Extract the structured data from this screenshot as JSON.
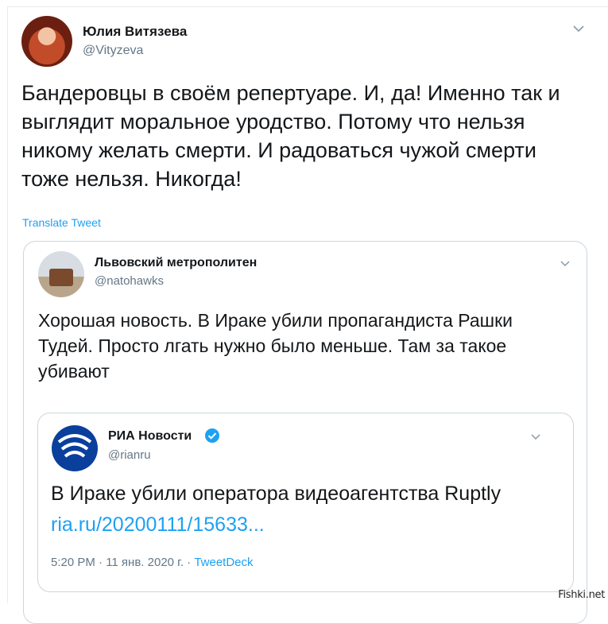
{
  "tweet": {
    "author_name": "Юлия Витязева",
    "author_handle": "@Vityzeva",
    "text": "Бандеровцы в своём репертуаре. И, да! Именно так и выглядит моральное уродство. Потому что нельзя никому желать смерти. И радоваться чужой смерти тоже нельзя. Никогда!",
    "translate_label": "Translate Tweet",
    "menu_icon": "chevron-down-icon"
  },
  "quoted": {
    "author_name": "Львовский метрополитен",
    "author_handle": "@natohawks",
    "text": "Хорошая новость. В Ираке убили пропагандиста Рашки Тудей. Просто лгать нужно было меньше. Там за такое убивают",
    "menu_icon": "chevron-down-icon"
  },
  "nested_quote": {
    "author_name": "РИА Новости",
    "author_handle": "@rianru",
    "text": "В Ираке убили оператора видеоагентства Ruptly",
    "link": "ria.ru/20200111/15633...",
    "timestamp": "5:20 PM · 11 янв. 2020 г. · ",
    "source": "TweetDeck",
    "verified_icon": "verified-badge-icon",
    "menu_icon": "chevron-down-icon"
  },
  "watermark": "Fishki.net",
  "colors": {
    "link": "#1da1f2",
    "secondary_text": "#657786",
    "border": "#ccd6dd"
  }
}
